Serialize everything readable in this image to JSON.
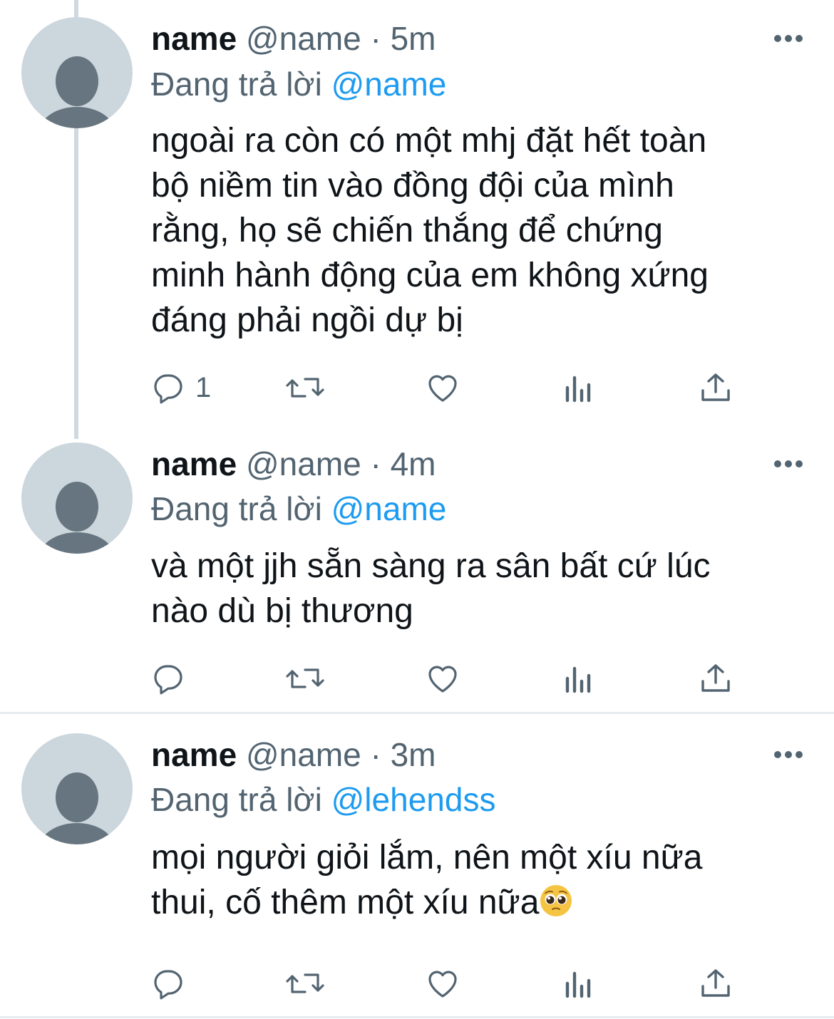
{
  "tweets": [
    {
      "display_name": "name",
      "meta": "@name · 5m",
      "reply_prefix": "Đang trả lời",
      "reply_to": "@name",
      "text": "ngoài ra còn có một mhj đặt hết toàn\nbộ niềm tin vào đồng đội của mình\nrằng, họ sẽ chiến thắng để chứng\nminh hành động của em không xứng\nđáng phải ngồi dự bị",
      "reply_count": "1",
      "emoji": ""
    },
    {
      "display_name": "name",
      "meta": "@name · 4m",
      "reply_prefix": "Đang trả lời",
      "reply_to": "@name",
      "text": "và một jjh sẵn sàng ra sân bất cứ lúc\nnào dù bị thương",
      "reply_count": "",
      "emoji": ""
    },
    {
      "display_name": "name",
      "meta": "@name · 3m",
      "reply_prefix": "Đang trả lời",
      "reply_to": "@lehendss",
      "text": "mọi người giỏi lắm, nên một xíu nữa\nthui, cố thêm một xíu nữa",
      "reply_count": "",
      "emoji": "pleading-face"
    }
  ],
  "colors": {
    "text": "#0f1419",
    "secondary": "#536471",
    "link": "#1d9bf0",
    "avatar_bg": "#ccd6dd",
    "avatar_fg": "#66757f",
    "divider": "#e6ecf0"
  },
  "icons": [
    "more-icon",
    "reply-icon",
    "retweet-icon",
    "like-icon",
    "views-icon",
    "share-icon"
  ]
}
